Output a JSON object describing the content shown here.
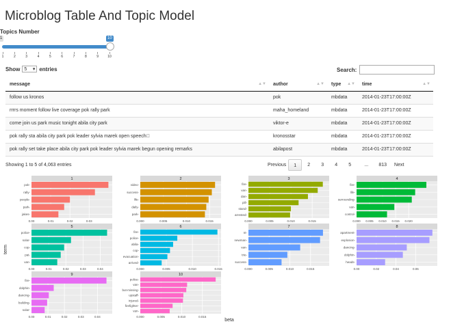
{
  "app": {
    "title": "Microblog Table And Topic Model"
  },
  "slider": {
    "label": "Topics Number",
    "min": 1,
    "max": 10,
    "value": 10,
    "min_label": "1",
    "max_label": "10",
    "ticks": [
      "1",
      "2",
      "3",
      "4",
      "5",
      "6",
      "7",
      "8",
      "9",
      "10"
    ]
  },
  "table_controls": {
    "show_label": "Show",
    "show_value": "5",
    "entries_label": "entries",
    "search_label": "Search:"
  },
  "table": {
    "columns": [
      "message",
      "author",
      "type",
      "time"
    ],
    "rows": [
      [
        "follow us kronos",
        "pok",
        "mbdata",
        "2014-01-23T17:00:00Z"
      ],
      [
        "rrrrs moment follow live coverage pok rally park",
        "maha_homeland",
        "mbdata",
        "2014-01-23T17:00:00Z"
      ],
      [
        "come join us park music tonight abila city park",
        "viktor-e",
        "mbdata",
        "2014-01-23T17:00:00Z"
      ],
      [
        "pok rally sta abila city park pok leader sylvia marek open speech\u0000",
        "kronosstar",
        "mbdata",
        "2014-01-23T17:00:00Z"
      ],
      [
        "pok rally set take place abila city park pok leader sylvia marek begun opening remarks",
        "abilapost",
        "mbdata",
        "2014-01-23T17:00:00Z"
      ]
    ]
  },
  "table_info": "Showing 1 to 5 of 4,063 entries",
  "pagination": {
    "previous": "Previous",
    "pages": [
      "1",
      "2",
      "3",
      "4",
      "5",
      "...",
      "813"
    ],
    "current": "1",
    "next": "Next"
  },
  "chart_data": {
    "type": "bar",
    "orientation": "horizontal",
    "ylabel": "term",
    "xlabel": "beta",
    "facets": [
      {
        "panel": "1",
        "color": "#F8766D",
        "terms": [
          "pok",
          "rally",
          "people",
          "park",
          "jakes"
        ],
        "values": [
          0.04,
          0.033,
          0.02,
          0.017,
          0.014
        ],
        "xlim": [
          0,
          0.042
        ],
        "ticks": [
          "0.00",
          "0.01",
          "0.02",
          "0.03"
        ]
      },
      {
        "panel": "2",
        "color": "#D39200",
        "terms": [
          "video",
          "success",
          "life",
          "daily",
          "park"
        ],
        "values": [
          0.0162,
          0.0155,
          0.0148,
          0.0143,
          0.014
        ],
        "xlim": [
          0,
          0.0175
        ],
        "ticks": [
          "0.000",
          "0.005",
          "0.010",
          "0.015"
        ]
      },
      {
        "panel": "3",
        "color": "#93AA00",
        "terms": [
          "fire",
          "van",
          "dan",
          "pill",
          "stand",
          "arrested"
        ],
        "values": [
          0.0175,
          0.0163,
          0.014,
          0.0118,
          0.01,
          0.0098
        ],
        "xlim": [
          0,
          0.019
        ],
        "ticks": [
          "0.000",
          "0.005",
          "0.010",
          "0.015"
        ]
      },
      {
        "panel": "4",
        "color": "#00BA38",
        "terms": [
          "fire",
          "life",
          "surrounding",
          "van",
          "control"
        ],
        "values": [
          0.0268,
          0.0225,
          0.0212,
          0.0145,
          0.0117
        ],
        "xlim": [
          0,
          0.031
        ],
        "ticks": [
          "0.000",
          "0.005",
          "0.010",
          "0.015",
          "0.020"
        ]
      },
      {
        "panel": "5",
        "color": "#00C19F",
        "terms": [
          "police",
          "solar",
          "cop",
          "pat",
          "van"
        ],
        "values": [
          0.044,
          0.023,
          0.019,
          0.017,
          0.015
        ],
        "xlim": [
          0,
          0.047
        ],
        "ticks": [
          "0.00",
          "0.01",
          "0.02",
          "0.03",
          "0.04"
        ]
      },
      {
        "panel": "6",
        "color": "#00B9E3",
        "terms": [
          "fire",
          "police",
          "abila",
          "cop",
          "evacuation",
          "arrived"
        ],
        "values": [
          0.0148,
          0.0071,
          0.0063,
          0.0057,
          0.0052,
          0.0041
        ],
        "xlim": [
          0,
          0.0155
        ],
        "ticks": [
          "0.000",
          "0.005",
          "0.010",
          "0.015"
        ]
      },
      {
        "panel": "7",
        "color": "#619CFF",
        "terms": [
          "nt",
          "newman",
          "van",
          "trie",
          "success"
        ],
        "values": [
          0.018,
          0.0173,
          0.0125,
          0.0094,
          0.008
        ],
        "xlim": [
          0,
          0.0195
        ],
        "ticks": [
          "0.000",
          "0.005",
          "0.010",
          "0.015"
        ]
      },
      {
        "panel": "8",
        "color": "#A79DFF",
        "terms": [
          "apartment",
          "explosion",
          "dancing",
          "dolphin",
          "heads"
        ],
        "values": [
          0.077,
          0.074,
          0.051,
          0.047,
          0.029
        ],
        "xlim": [
          0,
          0.082
        ],
        "ticks": [
          "0.00",
          "0.02",
          "0.04",
          "0.06"
        ]
      },
      {
        "panel": "9",
        "color": "#E76BF3",
        "terms": [
          "fire",
          "dolphin",
          "dancing",
          "building",
          "solar"
        ],
        "values": [
          0.0455,
          0.0135,
          0.0105,
          0.0095,
          0.008
        ],
        "xlim": [
          0,
          0.049
        ],
        "ticks": [
          "0.00",
          "0.01",
          "0.02",
          "0.03",
          "0.04"
        ]
      },
      {
        "panel": "10",
        "color": "#FF67C8",
        "terms": [
          "police",
          "van",
          "but-missing",
          "upstaff",
          "injured",
          "firefighter",
          "van"
        ],
        "values": [
          0.0182,
          0.0113,
          0.0111,
          0.0104,
          0.0103,
          0.0078,
          0.0071
        ],
        "xlim": [
          0,
          0.0195
        ],
        "ticks": [
          "0.000",
          "0.005",
          "0.010",
          "0.015"
        ]
      }
    ]
  }
}
